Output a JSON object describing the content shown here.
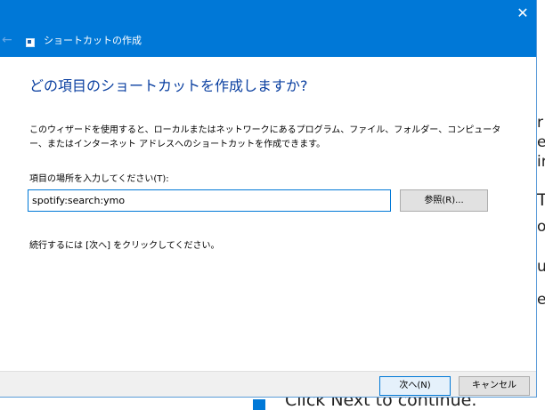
{
  "dialog": {
    "title": "ショートカットの作成",
    "close_glyph": "✕",
    "back_glyph": "←",
    "heading": "どの項目のショートカットを作成しますか?",
    "description": "このウィザードを使用すると、ローカルまたはネットワークにあるプログラム、ファイル、フォルダー、コンピューター、またはインターネット アドレスへのショートカットを作成できます。",
    "location_label": "項目の場所を入力してください(T):",
    "location_value": "spotify:search:ymo",
    "browse_label": "参照(R)...",
    "hint": "続行するには [次へ] をクリックしてください。",
    "next_label": "次へ(N)",
    "cancel_label": "キャンセル"
  },
  "background": {
    "fragments": [
      "r",
      "e",
      "ir",
      "T",
      "o",
      "u",
      "e"
    ],
    "bottom_text": "Click Next to continue."
  },
  "colors": {
    "titlebar": "#0078d7",
    "heading": "#0a3fa0",
    "accent": "#0078d7"
  }
}
